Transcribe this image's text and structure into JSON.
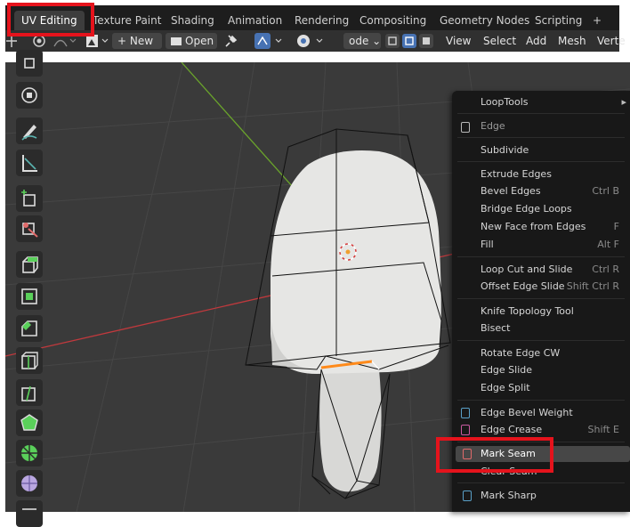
{
  "workspace_tabs": [
    "UV Editing",
    "Texture Paint",
    "Shading",
    "Animation",
    "Rendering",
    "Compositing",
    "Geometry Nodes",
    "Scripting",
    "+"
  ],
  "active_tab": "UV Editing",
  "toolbar": {
    "new_label": "New",
    "open_label": "Open",
    "mode_label": "ode",
    "view_label": "View",
    "select_label": "Select",
    "add_label": "Add",
    "mesh_label": "Mesh",
    "vertex_label": "Verte"
  },
  "tool_icons": [
    "cursor-icon",
    "move-icon",
    "annotate-icon",
    "measure-icon",
    "add-cube-icon",
    "transform-icon",
    "extrude-icon",
    "inset-icon",
    "bevel-icon",
    "loop-cut-icon",
    "knife-icon",
    "poly-build-icon",
    "spin-icon",
    "smooth-icon",
    "shrink-icon"
  ],
  "context_menu": {
    "loop_tools": "LoopTools",
    "edge_header": "Edge",
    "subdivide": "Subdivide",
    "extrude_edges": "Extrude Edges",
    "bevel_edges": "Bevel Edges",
    "bevel_edges_sc": "Ctrl B",
    "bridge_edge_loops": "Bridge Edge Loops",
    "new_face": "New Face from Edges",
    "new_face_sc": "F",
    "fill": "Fill",
    "fill_sc": "Alt F",
    "loop_cut": "Loop Cut and Slide",
    "loop_cut_sc": "Ctrl R",
    "offset_edge": "Offset Edge Slide",
    "offset_edge_sc": "Shift Ctrl R",
    "knife": "Knife Topology Tool",
    "bisect": "Bisect",
    "rotate_edge": "Rotate Edge CW",
    "edge_slide": "Edge Slide",
    "edge_split": "Edge Split",
    "bevel_weight": "Edge Bevel Weight",
    "edge_crease": "Edge Crease",
    "edge_crease_sc": "Shift E",
    "mark_seam": "Mark Seam",
    "clear_seam": "Clear Seam",
    "mark_sharp": "Mark Sharp"
  },
  "colors": {
    "highlight_red": "#e5131c",
    "axis_red": "#c0393d",
    "axis_green": "#6aa42b",
    "seam_orange": "#ff8a1a"
  }
}
